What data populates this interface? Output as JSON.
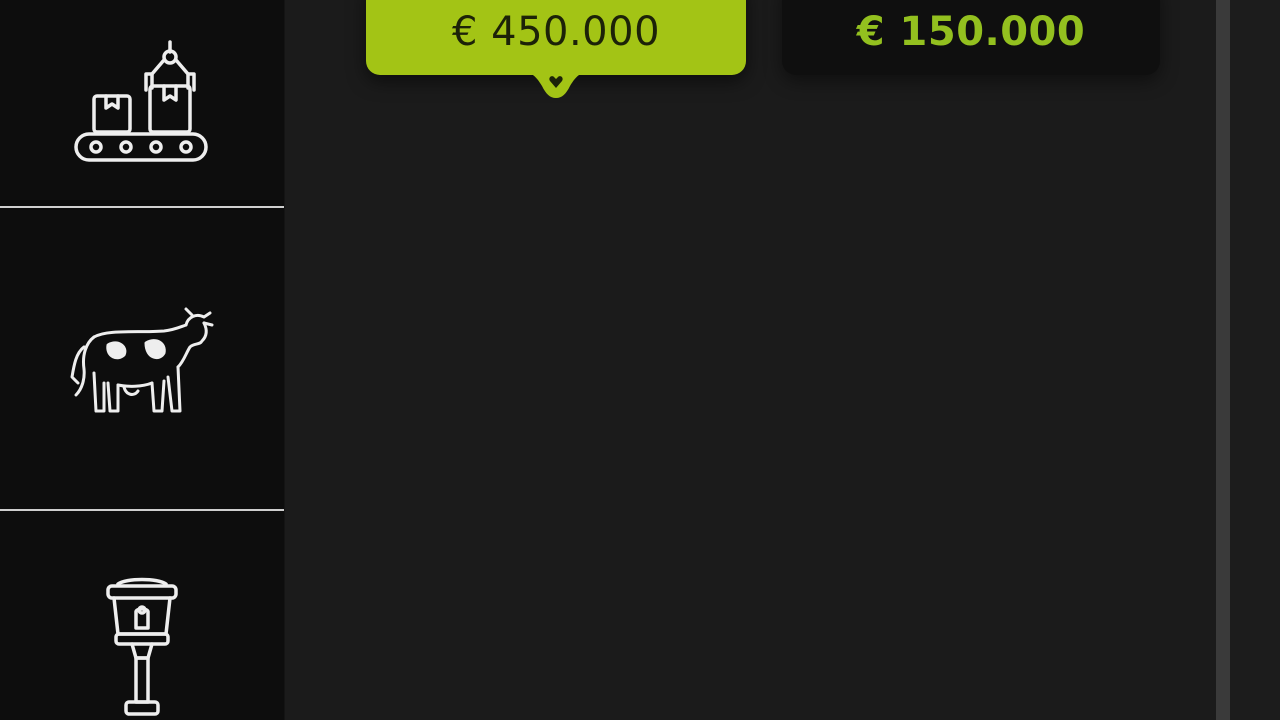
{
  "sidebar": {
    "items": [
      {
        "icon": "factory-conveyor-icon"
      },
      {
        "icon": "cow-icon"
      },
      {
        "icon": "street-lamp-icon"
      }
    ],
    "icon_color": "#eeeeee"
  },
  "price_options": [
    {
      "label": "€ 450.000",
      "selected": true
    },
    {
      "label": "€ 150.000",
      "selected": false
    }
  ],
  "colors": {
    "accent": "#a3c415",
    "accent_text": "#93c01f",
    "background": "#1b1b1b",
    "sidebar": "#0d0d0d"
  }
}
